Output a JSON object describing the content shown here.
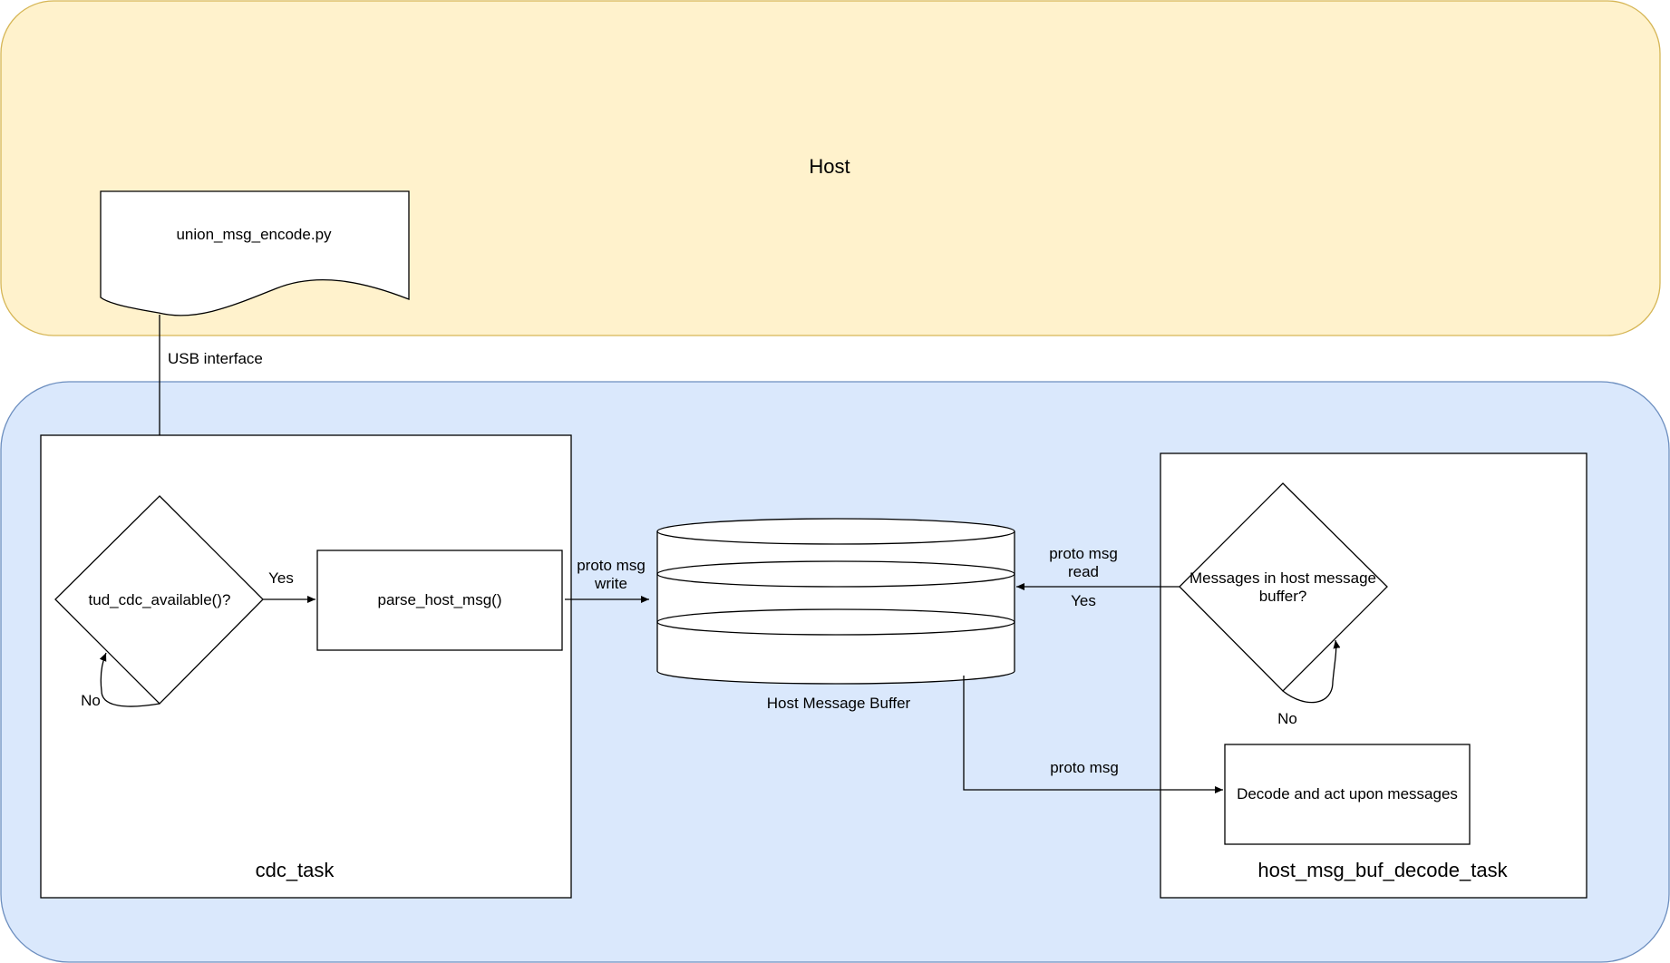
{
  "colors": {
    "host_fill": "#FFF2CC",
    "host_stroke": "#D6B656",
    "device_fill": "#DAE8FC",
    "device_stroke": "#6C8EBF",
    "shape_fill": "#FFFFFF",
    "line": "#000000"
  },
  "host": {
    "title": "Host",
    "script_file": "union_msg_encode.py"
  },
  "usb_label": "USB interface",
  "cdc_task": {
    "title": "cdc_task",
    "decision": "tud_cdc_available()?",
    "yes_label": "Yes",
    "no_label": "No",
    "process": "parse_host_msg()"
  },
  "write_label_1": "proto msg",
  "write_label_2": "write",
  "buffer": {
    "label": "Host Message Buffer"
  },
  "decode_task": {
    "title": "host_msg_buf_decode_task",
    "decision_line_1": "Messages in host message",
    "decision_line_2": "buffer?",
    "yes_label": "Yes",
    "no_label": "No",
    "process": "Decode and act upon messages"
  },
  "read_label_1": "proto msg",
  "read_label_2": "read",
  "msg_label": "proto msg"
}
